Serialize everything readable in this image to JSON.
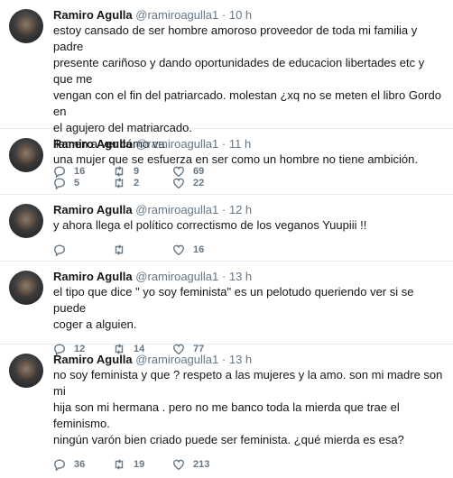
{
  "tweets": [
    {
      "name": "Ramiro Agulla",
      "handle": "@ramiroagulla1",
      "separator": "·",
      "time": "10 h",
      "lines": [
        "estoy cansado de ser hombre amoroso proveedor de toda mi familia y padre",
        "presente cariñoso y dando oportunidades de educacion libertades etc y que me",
        "vengan con el fin del patriarcado. molestan ¿xq no se meten  el libro Gordo en",
        "el agujero del matriarcado.",
        "llamen a ver cómo va."
      ],
      "replies": "16",
      "retweets": "9",
      "likes": "69"
    },
    {
      "name": "Ramiro Agulla",
      "handle": "@ramiroagulla1",
      "separator": "·",
      "time": "11 h",
      "lines": [
        "una mujer que se esfuerza en ser como un hombre no tiene ambición."
      ],
      "replies": "5",
      "retweets": "2",
      "likes": "22"
    },
    {
      "name": "Ramiro Agulla",
      "handle": "@ramiroagulla1",
      "separator": "·",
      "time": "12 h",
      "lines": [
        "y ahora llega el político correctismo de los veganos  Yuupiii !!"
      ],
      "replies": "",
      "retweets": "",
      "likes": "16"
    },
    {
      "name": "Ramiro Agulla",
      "handle": "@ramiroagulla1",
      "separator": "·",
      "time": "13 h",
      "lines": [
        "el tipo que dice \" yo soy feminista\" es un pelotudo queriendo ver si se puede",
        "coger a alguien."
      ],
      "replies": "12",
      "retweets": "14",
      "likes": "77"
    },
    {
      "name": "Ramiro Agulla",
      "handle": "@ramiroagulla1",
      "separator": "·",
      "time": "13 h",
      "lines": [
        "no soy feminista y que ? respeto a las mujeres y la amo. son mi madre son mi",
        "hija son mi hermana . pero no me banco toda la mierda que trae el feminismo.",
        "ningún varón bien criado puede ser feminista. ¿qué mierda es esa?"
      ],
      "replies": "36",
      "retweets": "19",
      "likes": "213"
    }
  ],
  "icons": {
    "reply": "reply-icon",
    "retweet": "retweet-icon",
    "like": "heart-icon"
  }
}
